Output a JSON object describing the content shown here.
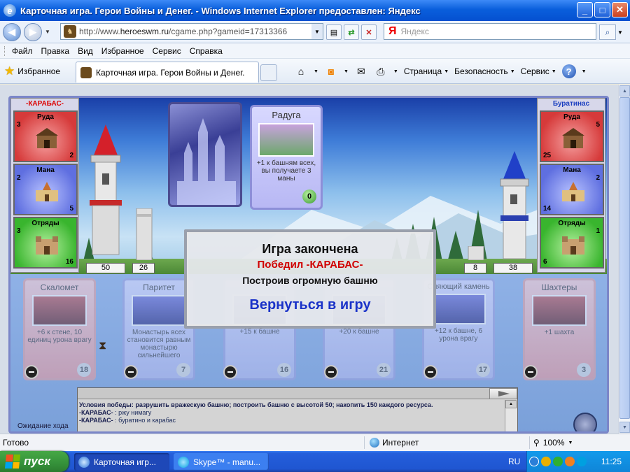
{
  "window": {
    "title": "Карточная игра. Герои Войны и Денег. - Windows Internet Explorer предоставлен: Яндекс",
    "buttons": {
      "minimize": "_",
      "maximize": "□",
      "close": "✕"
    }
  },
  "address_bar": {
    "url_prefix": "http://www.",
    "url_domain": "heroeswm.ru",
    "url_rest": "/cgame.php?gameid=17313366",
    "search_placeholder": "Яндекс",
    "search_logo": "Я"
  },
  "menu": [
    "Файл",
    "Правка",
    "Вид",
    "Избранное",
    "Сервис",
    "Справка"
  ],
  "favorites_bar": {
    "favorites_label": "Избранное",
    "tab_title": "Карточная игра. Герои Войны и Денег.",
    "commands": [
      "Страница",
      "Безопасность",
      "Сервис"
    ]
  },
  "game": {
    "left_player": {
      "name": "-КАРАБАС-",
      "color": "#dd0000",
      "resources": [
        {
          "label": "Руда",
          "income": "3",
          "amount": "2",
          "kind": "ore"
        },
        {
          "label": "Мана",
          "income": "2",
          "amount": "5",
          "kind": "mana"
        },
        {
          "label": "Отряды",
          "income": "3",
          "amount": "16",
          "kind": "troops"
        }
      ],
      "tower": "50",
      "wall": "26"
    },
    "right_player": {
      "name": "Буратинас",
      "color": "#1a3ec0",
      "resources": [
        {
          "label": "Руда",
          "income": "5",
          "amount": "25",
          "kind": "ore"
        },
        {
          "label": "Мана",
          "income": "2",
          "amount": "14",
          "kind": "mana"
        },
        {
          "label": "Отряды",
          "income": "1",
          "amount": "6",
          "kind": "troops"
        }
      ],
      "tower": "38",
      "wall": "8"
    },
    "played_card": {
      "name": "Радуга",
      "desc": "+1 к башням всех, вы получаете 3 маны",
      "cost": "0"
    },
    "hand": [
      {
        "name": "Скаломет",
        "desc": "+6 к стене, 10 единиц урона врагу",
        "cost": "18",
        "color": "red"
      },
      {
        "name": "Паритет",
        "desc": "Монастырь всех становится равным монастырю сильнейшего",
        "cost": "7",
        "color": "blue"
      },
      {
        "name": "",
        "desc": "+15 к башне",
        "cost": "16",
        "color": "blue"
      },
      {
        "name": "",
        "desc": "+20 к башне",
        "cost": "21",
        "color": "blue"
      },
      {
        "name": "Сияющий камень",
        "desc": "+12 к башне, 6 урона врагу",
        "cost": "17",
        "color": "blue"
      },
      {
        "name": "Шахтеры",
        "desc": "+1 шахта",
        "cost": "3",
        "color": "red"
      }
    ],
    "modal": {
      "title": "Игра закончена",
      "winner": "Победил -КАРАБАС-",
      "reason": "Построив огромную башню",
      "return_link": "Вернуться в игру"
    },
    "log": {
      "lines": [
        {
          "text": "Условия победы: разрушить вражескую башню; построить башню с высотой 50; накопить 150 каждого ресурса."
        },
        {
          "author": "-КАРАБАС-",
          "text": " : ржу нимагу"
        },
        {
          "author": "-КАРАБАС-",
          "text": " : буратино и карабас"
        }
      ]
    },
    "waiting": "Ожидание хода"
  },
  "status_bar": {
    "ready": "Готово",
    "zone": "Интернет",
    "zoom": "100%"
  },
  "taskbar": {
    "start": "пуск",
    "tasks": [
      "Карточная игр...",
      "Skype™ - manu..."
    ],
    "lang": "RU",
    "clock": "11:25"
  }
}
